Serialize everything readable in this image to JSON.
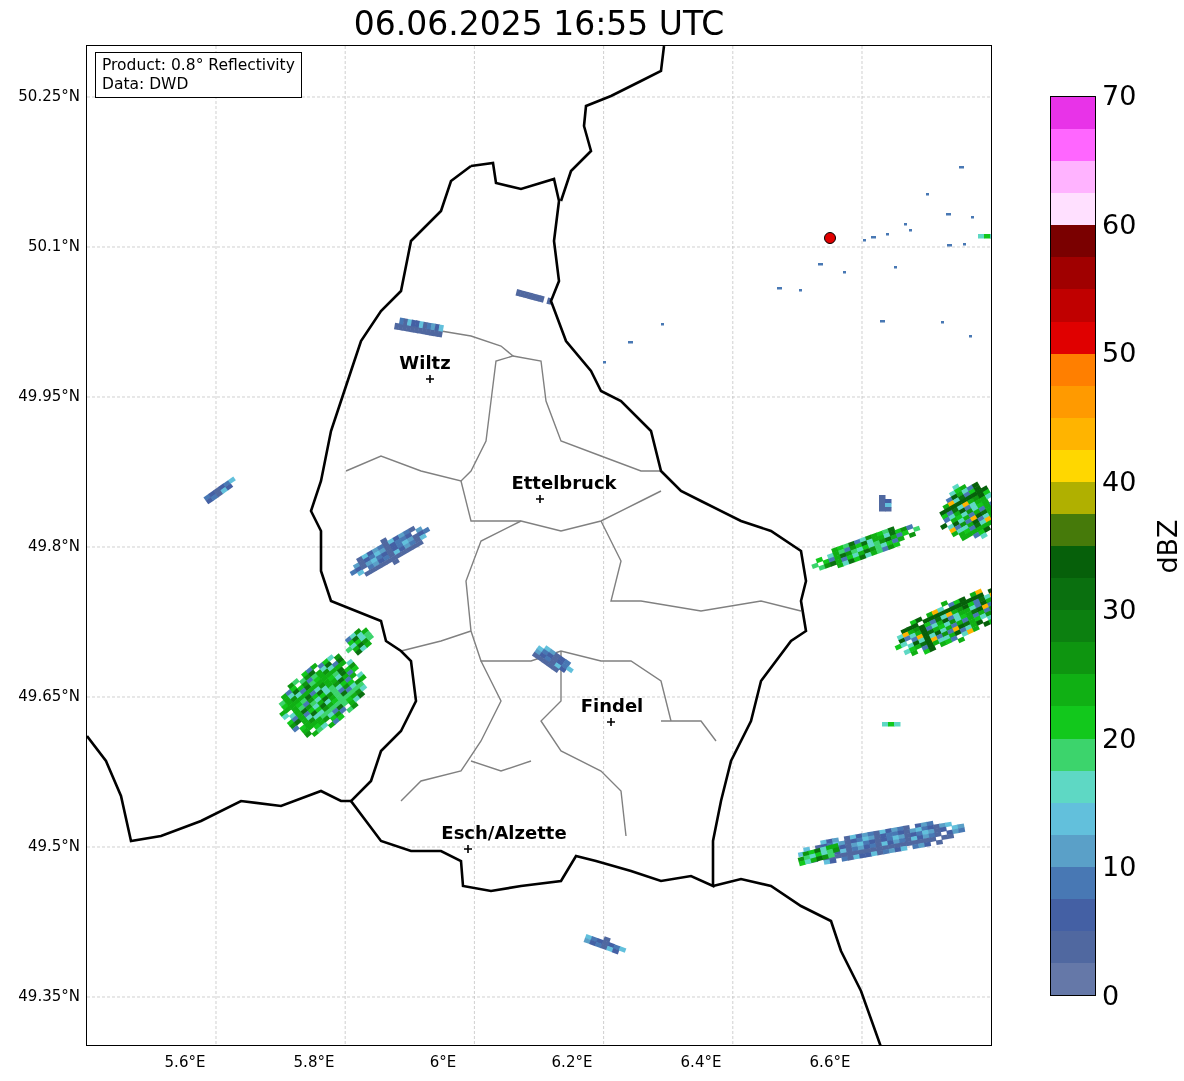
{
  "title": "06.06.2025 16:55 UTC",
  "info_box": [
    "Product: 0.8° Reflectivity",
    "Data: DWD"
  ],
  "y_ticks": [
    "50.25°N",
    "50.1°N",
    "49.95°N",
    "49.8°N",
    "49.65°N",
    "49.5°N",
    "49.35°N"
  ],
  "x_ticks": [
    "5.6°E",
    "5.8°E",
    "6°E",
    "6.2°E",
    "6.4°E",
    "6.6°E"
  ],
  "cities": [
    {
      "name": "Wiltz"
    },
    {
      "name": "Ettelbruck"
    },
    {
      "name": "Findel"
    },
    {
      "name": "Esch/Alzette"
    }
  ],
  "colorbar": {
    "label": "dBZ",
    "ticks": [
      "70",
      "60",
      "50",
      "40",
      "30",
      "20",
      "10",
      "0"
    ],
    "segments": [
      {
        "color": "#e833e8"
      },
      {
        "color": "#ff66ff"
      },
      {
        "color": "#ffb3ff"
      },
      {
        "color": "#ffe0ff"
      },
      {
        "color": "#7a0000"
      },
      {
        "color": "#a00000"
      },
      {
        "color": "#c00000"
      },
      {
        "color": "#e00000"
      },
      {
        "color": "#ff7f00"
      },
      {
        "color": "#ff9a00"
      },
      {
        "color": "#ffb400"
      },
      {
        "color": "#ffd700"
      },
      {
        "color": "#b0b000"
      },
      {
        "color": "#467a0a"
      },
      {
        "color": "#06600a"
      },
      {
        "color": "#0a700f"
      },
      {
        "color": "#0c8010"
      },
      {
        "color": "#0e9510"
      },
      {
        "color": "#10b014"
      },
      {
        "color": "#12c81c"
      },
      {
        "color": "#3cd46c"
      },
      {
        "color": "#5ed8c4"
      },
      {
        "color": "#62c0dc"
      },
      {
        "color": "#5aa0c8"
      },
      {
        "color": "#4878b4"
      },
      {
        "color": "#4460a4"
      },
      {
        "color": "#5068a0"
      },
      {
        "color": "#6578a8"
      }
    ]
  }
}
